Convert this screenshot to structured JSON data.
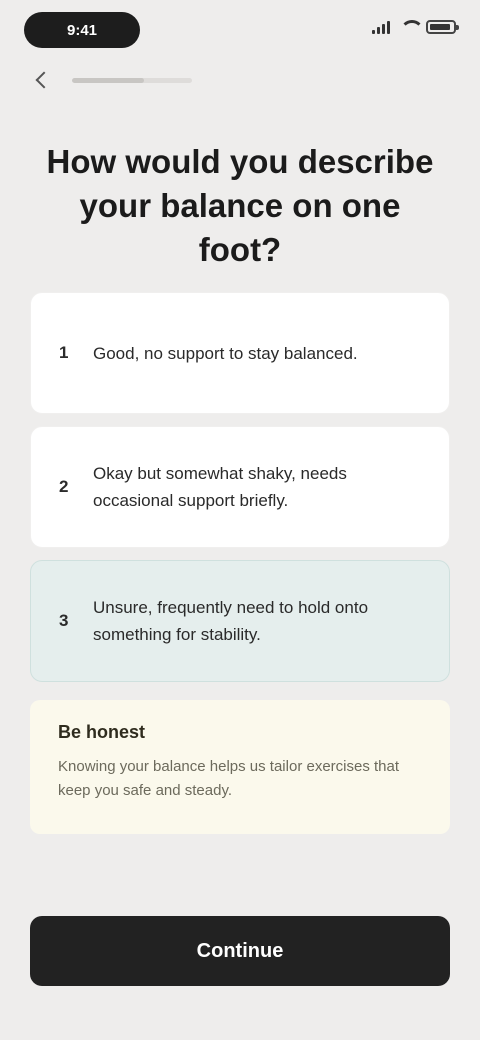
{
  "status_bar": {
    "time": "9:41",
    "battery_level": 0.9
  },
  "nav": {
    "progress": 0.6
  },
  "question": {
    "text": "How would you describe your balance on one foot?"
  },
  "options": [
    {
      "number": "1",
      "text": "Good, no support to stay balanced.",
      "selected": false
    },
    {
      "number": "2",
      "text": "Okay but somewhat shaky, needs occasional support briefly.",
      "selected": false
    },
    {
      "number": "3",
      "text": "Unsure, frequently need to hold onto something for stability.",
      "selected": true
    }
  ],
  "feedback": {
    "title": "Be honest",
    "text": "Knowing your balance helps us tailor exercises that keep you safe and steady."
  },
  "cta": {
    "label": "Continue"
  }
}
